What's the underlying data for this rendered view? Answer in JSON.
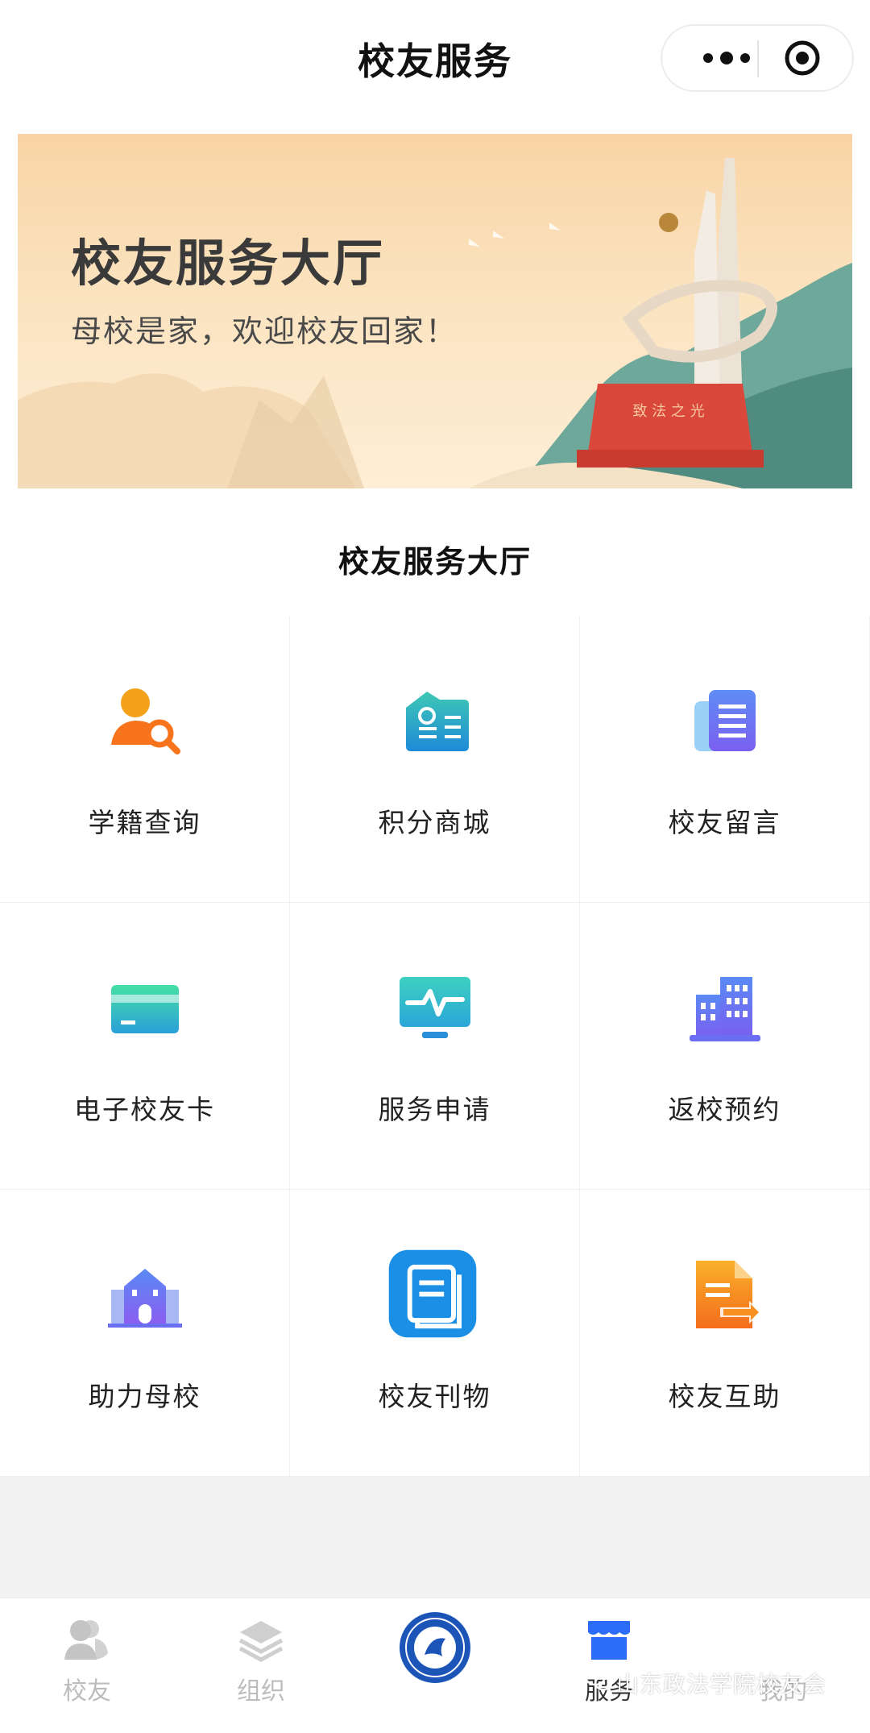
{
  "header": {
    "title": "校友服务"
  },
  "banner": {
    "title": "校友服务大厅",
    "subtitle": "母校是家，欢迎校友回家！",
    "statue_inscription": "致 法 之 光"
  },
  "section": {
    "title": "校友服务大厅"
  },
  "services": [
    {
      "label": "学籍查询",
      "icon": "person-search-icon"
    },
    {
      "label": "积分商城",
      "icon": "id-card-icon"
    },
    {
      "label": "校友留言",
      "icon": "document-icon"
    },
    {
      "label": "电子校友卡",
      "icon": "card-icon"
    },
    {
      "label": "服务申请",
      "icon": "monitor-pulse-icon"
    },
    {
      "label": "返校预约",
      "icon": "buildings-icon"
    },
    {
      "label": "助力母校",
      "icon": "school-building-icon"
    },
    {
      "label": "校友刊物",
      "icon": "book-icon"
    },
    {
      "label": "校友互助",
      "icon": "file-transfer-icon"
    }
  ],
  "tabbar": {
    "items": [
      {
        "label": "校友",
        "icon": "people-icon",
        "active": false
      },
      {
        "label": "组织",
        "icon": "layers-icon",
        "active": false
      },
      {
        "label": "",
        "icon": "school-logo",
        "active": false
      },
      {
        "label": "服务",
        "icon": "store-icon",
        "active": true
      },
      {
        "label": "我的",
        "icon": "user-icon",
        "active": false
      }
    ]
  },
  "watermark": {
    "text": "山东政法学院校友会"
  },
  "colors": {
    "accent_blue": "#2d6cf6",
    "banner_bg": "#f9d4a5",
    "monument_red": "#d9483b"
  }
}
